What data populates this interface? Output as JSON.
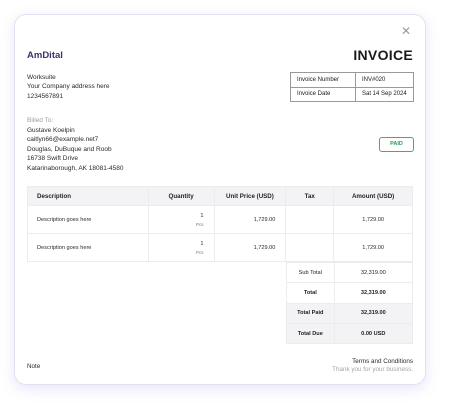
{
  "close_icon": "close-icon",
  "brand": {
    "prefix": "Am",
    "name": "Dital"
  },
  "title": "INVOICE",
  "company": {
    "name": "Worksuite",
    "address": "Your Company address here",
    "phone": "1234567891"
  },
  "meta": {
    "number_label": "Invoice Number",
    "number_value": "INV#020",
    "date_label": "Invoice Date",
    "date_value": "Sat 14 Sep 2024"
  },
  "billed": {
    "label": "Billed To:",
    "name": "Gustave Koelpin",
    "email": "caitlyn66@example.net7",
    "company": "Douglas, DuBuque and Roob",
    "street": "16738 Swift Drive",
    "city": "Katarinaborough, AK 18081-4580"
  },
  "status_badge": "PAID",
  "status_color": "#2d9a57",
  "table": {
    "headers": [
      "Description",
      "Quantity",
      "Unit Price (USD)",
      "Tax",
      "Amount (USD)"
    ],
    "rows": [
      {
        "description": "Description goes here",
        "qty": "1",
        "qty_unit": "Pcs",
        "unit_price": "1,729.00",
        "tax": "",
        "amount": "1,729.00"
      },
      {
        "description": "Description goes here",
        "qty": "1",
        "qty_unit": "Pcs",
        "unit_price": "1,729.00",
        "tax": "",
        "amount": "1,729.00"
      }
    ]
  },
  "totals": {
    "sub_total_label": "Sub Total",
    "sub_total_value": "32,319.00",
    "total_label": "Total",
    "total_value": "32,319.00",
    "total_paid_label": "Total Paid",
    "total_paid_value": "32,319.00",
    "total_due_label": "Total Due",
    "total_due_value": "0.00 USD"
  },
  "footer": {
    "note": "Note",
    "terms_title": "Terms and Conditions",
    "terms_text": "Thank you for your business."
  }
}
